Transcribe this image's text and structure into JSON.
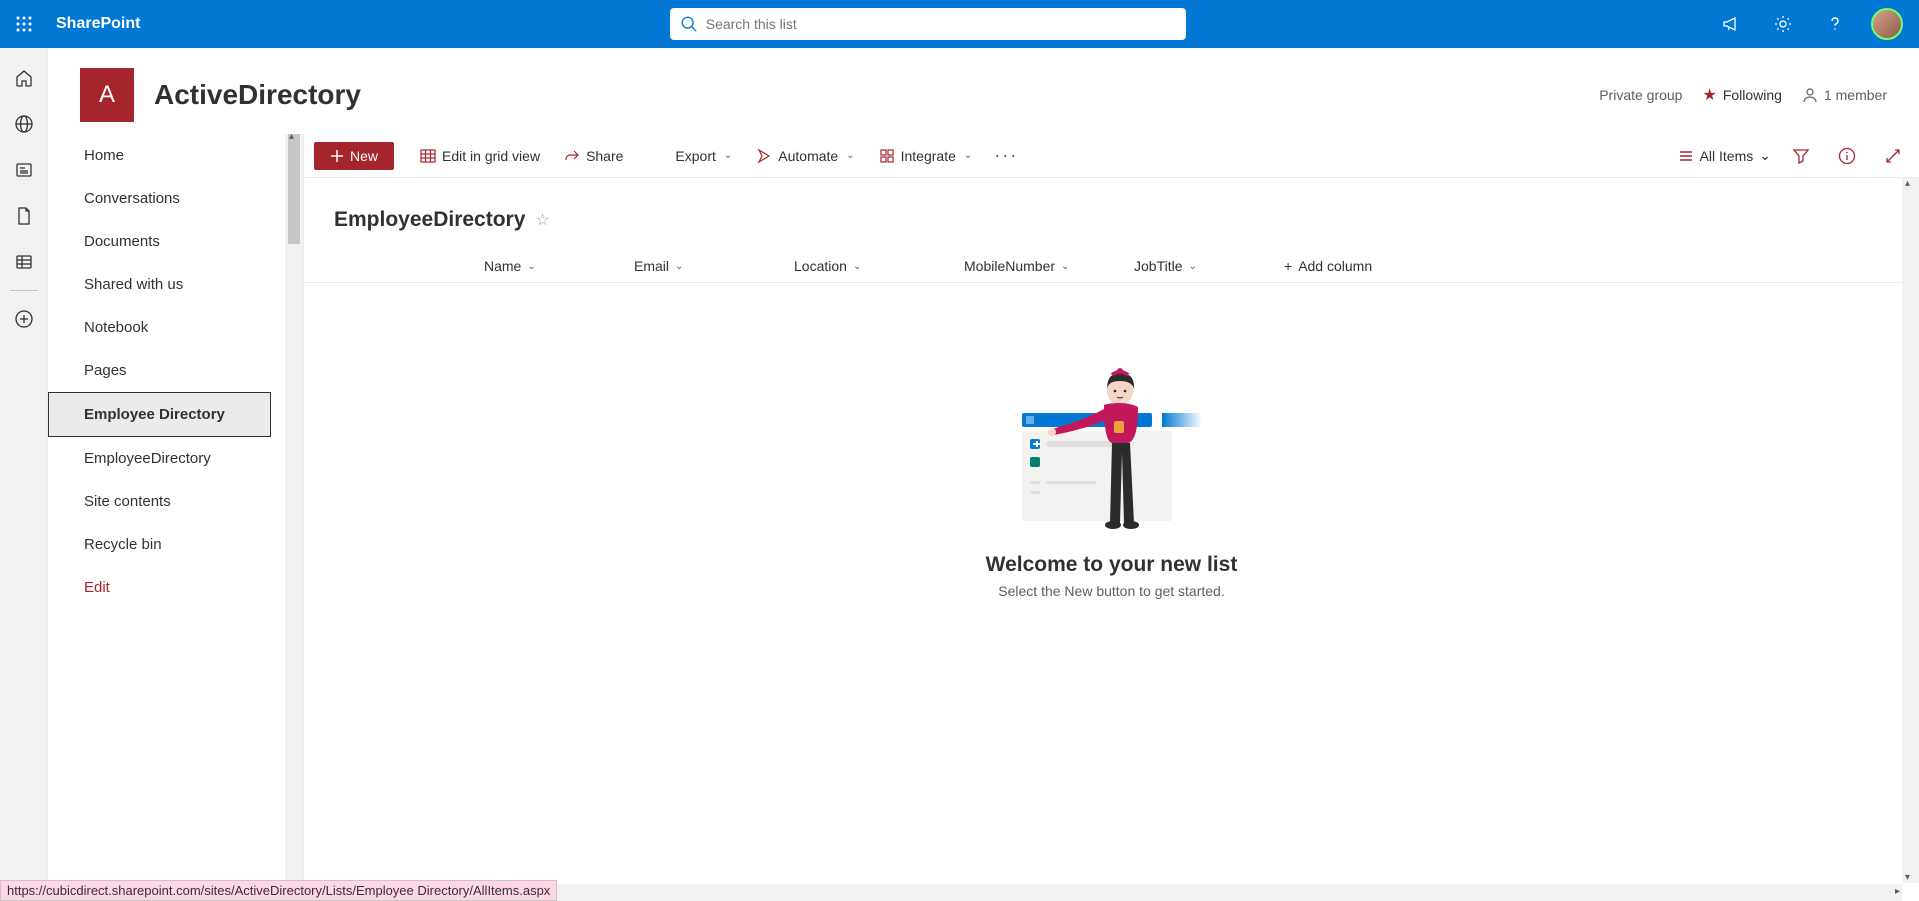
{
  "brand": "SharePoint",
  "search": {
    "placeholder": "Search this list"
  },
  "site": {
    "logo_letter": "A",
    "name": "ActiveDirectory",
    "privacy": "Private group",
    "following": "Following",
    "members": "1 member"
  },
  "nav": {
    "items": [
      {
        "label": "Home"
      },
      {
        "label": "Conversations"
      },
      {
        "label": "Documents"
      },
      {
        "label": "Shared with us"
      },
      {
        "label": "Notebook"
      },
      {
        "label": "Pages"
      },
      {
        "label": "Employee Directory",
        "selected": true
      },
      {
        "label": "EmployeeDirectory"
      },
      {
        "label": "Site contents"
      },
      {
        "label": "Recycle bin"
      },
      {
        "label": "Edit",
        "edit": true
      }
    ]
  },
  "commands": {
    "new": "New",
    "grid": "Edit in grid view",
    "share": "Share",
    "export": "Export",
    "automate": "Automate",
    "integrate": "Integrate",
    "view": "All Items"
  },
  "list": {
    "title": "EmployeeDirectory",
    "columns": [
      "Name",
      "Email",
      "Location",
      "MobileNumber",
      "JobTitle"
    ],
    "add_column": "Add column"
  },
  "empty": {
    "title": "Welcome to your new list",
    "subtitle": "Select the New button to get started."
  },
  "statusbar": "https://cubicdirect.sharepoint.com/sites/ActiveDirectory/Lists/Employee Directory/AllItems.aspx"
}
